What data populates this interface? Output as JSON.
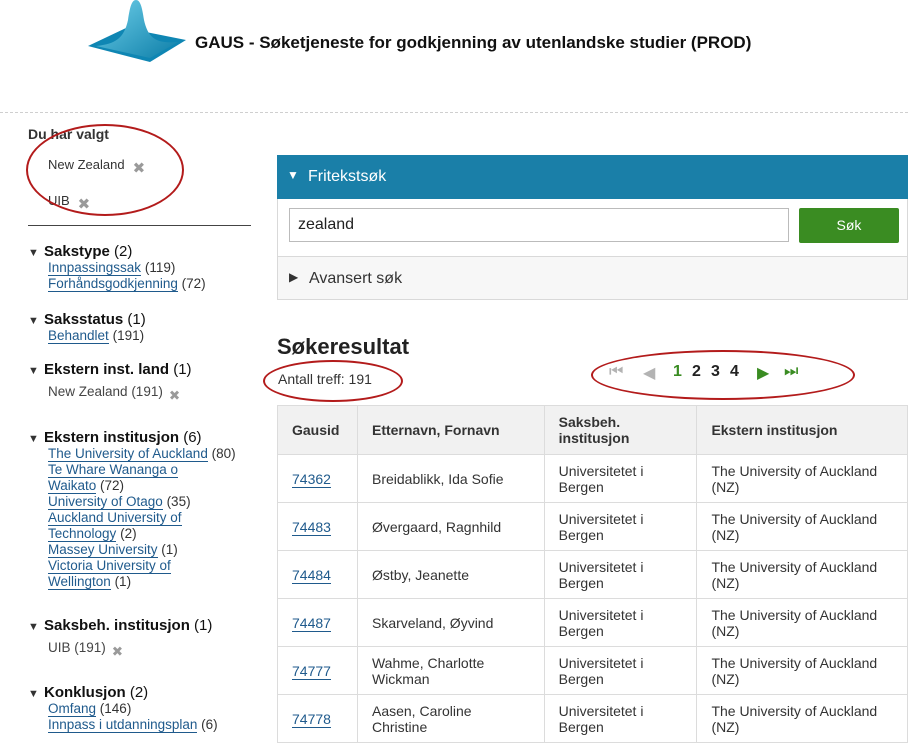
{
  "header": {
    "title": "GAUS - Søketjeneste for godkjenning av utenlandske studier (PROD)"
  },
  "sidebar": {
    "chosen_title": "Du har valgt",
    "chosen": [
      "New Zealand",
      "UIB"
    ],
    "facets": [
      {
        "title": "Sakstype",
        "count": "(2)",
        "items": [
          {
            "label": "Innpassingssak",
            "count": "(119)"
          },
          {
            "label": "Forhåndsgodkjenning",
            "count": "(72)"
          }
        ]
      },
      {
        "title": "Saksstatus",
        "count": "(1)",
        "items": [
          {
            "label": "Behandlet",
            "count": "(191)"
          }
        ]
      },
      {
        "title": "Ekstern inst. land",
        "count": "(1)",
        "selected": "New Zealand",
        "selected_count": "(191)"
      },
      {
        "title": "Ekstern institusjon",
        "count": "(6)",
        "items": [
          {
            "label": "The University of Auckland",
            "count": "(80)"
          },
          {
            "label": "Te Whare Wananga o",
            "label2": "Waikato",
            "count": "(72)"
          },
          {
            "label": "University of Otago",
            "count": "(35)"
          },
          {
            "label": "Auckland University of",
            "label2": "Technology",
            "count": "(2)"
          },
          {
            "label": "Massey University",
            "count": "(1)"
          },
          {
            "label": "Victoria University of",
            "label2": "Wellington",
            "count": "(1)"
          }
        ]
      },
      {
        "title": "Saksbeh. institusjon",
        "count": "(1)",
        "selected": "UIB",
        "selected_count": "(191)"
      },
      {
        "title": "Konklusjon",
        "count": "(2)",
        "items": [
          {
            "label": "Omfang",
            "count": "(146)"
          },
          {
            "label": "Innpass i utdanningsplan",
            "count": "(6)"
          }
        ]
      }
    ]
  },
  "search": {
    "fritekst_label": "Fritekstsøk",
    "query": "zealand",
    "button_label": "Søk",
    "advanced_label": "Avansert søk"
  },
  "results": {
    "title": "Søkeresultat",
    "count_text": "Antall treff: 191",
    "pager": {
      "pages": [
        "1",
        "2",
        "3",
        "4"
      ],
      "current": "1"
    },
    "columns": [
      "Gausid",
      "Etternavn, Fornavn",
      "Saksbeh. institusjon",
      "Ekstern institusjon"
    ],
    "rows": [
      {
        "id": "74362",
        "name": "Breidablikk, Ida Sofie",
        "inst": "Universitetet i Bergen",
        "ext": "The University of Auckland (NZ)"
      },
      {
        "id": "74483",
        "name": "Øvergaard, Ragnhild",
        "inst": "Universitetet i Bergen",
        "ext": "The University of Auckland (NZ)"
      },
      {
        "id": "74484",
        "name": "Østby, Jeanette",
        "inst": "Universitetet i Bergen",
        "ext": "The University of Auckland (NZ)"
      },
      {
        "id": "74487",
        "name": "Skarveland, Øyvind",
        "inst": "Universitetet i Bergen",
        "ext": "The University of Auckland (NZ)"
      },
      {
        "id": "74777",
        "name": "Wahme, Charlotte Wickman",
        "inst": "Universitetet i Bergen",
        "ext": "The University of Auckland (NZ)"
      },
      {
        "id": "74778",
        "name": "Aasen, Caroline Christine",
        "inst": "Universitetet i Bergen",
        "ext": "The University of Auckland (NZ)"
      }
    ]
  },
  "colors": {
    "accent": "#1a7fa8",
    "button": "#3a8c22",
    "link": "#1f5a8c",
    "annotation": "#b31b1b"
  }
}
